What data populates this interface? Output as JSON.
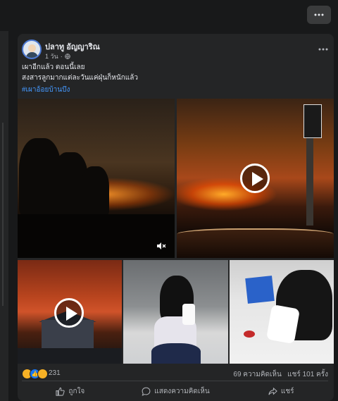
{
  "post": {
    "author": "ปลาทู อัญญาริณ",
    "time": "1 วัน",
    "text_line1": "เผาอีกแล้ว ตอนนี้เลย",
    "text_line2": "สงสารลูกมากแต่ละวันแค่ฝุ่นก็หนักแล้ว",
    "hashtag": "#เผาอ้อยบ้านบึง"
  },
  "stats": {
    "reactions_count": "231",
    "comments": "69 ความคิดเห็น",
    "shares": "แชร์ 101 ครั้ง"
  },
  "actions": {
    "like": "ถูกใจ",
    "comment": "แสดงความคิดเห็น",
    "share": "แชร์"
  },
  "icons": {
    "top_more": "more-horizontal-icon",
    "globe": "globe-icon",
    "mute": "mute-icon",
    "play": "play-icon"
  },
  "colors": {
    "background": "#18191a",
    "card": "#242526",
    "hashtag": "#4599ff",
    "like_blue": "#1877f2"
  }
}
